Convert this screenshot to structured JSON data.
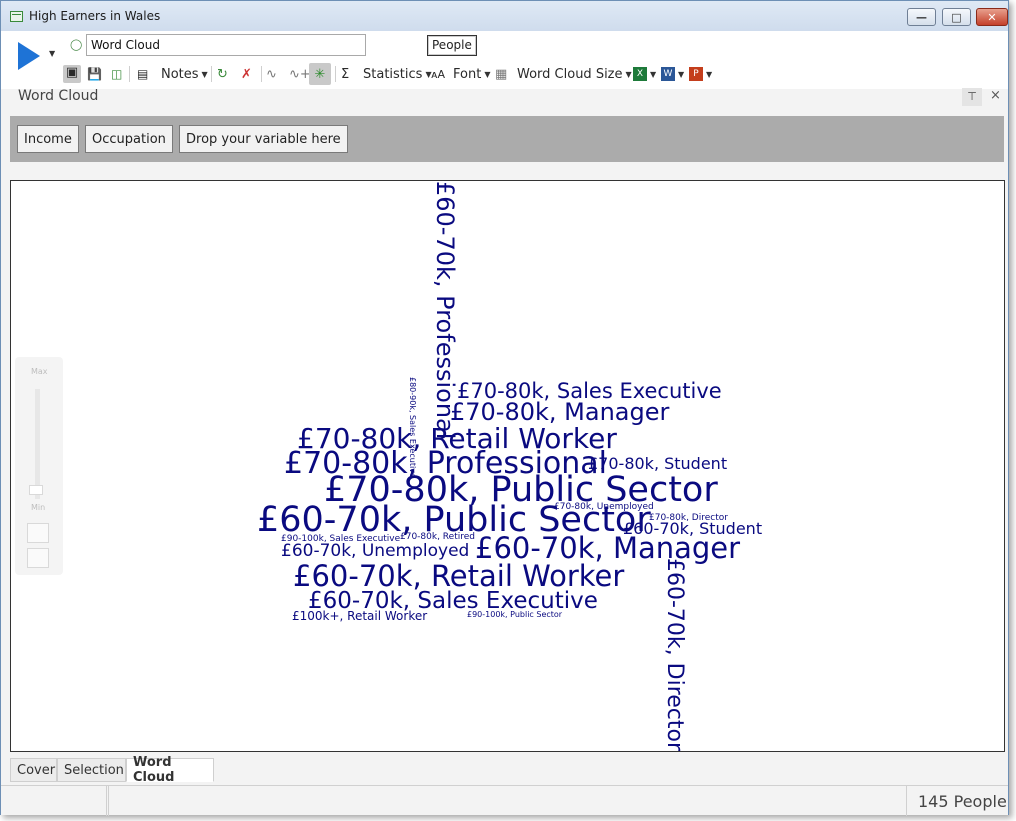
{
  "window": {
    "title": "High Earners in Wales"
  },
  "ribbon": {
    "name_value": "Word Cloud",
    "selection_label": "People",
    "notes_label": "Notes",
    "statistics_label": "Statistics",
    "font_label": "Font",
    "size_label": "Word Cloud Size"
  },
  "panel": {
    "title": "Word Cloud"
  },
  "variables": [
    "Income",
    "Occupation",
    "Drop your variable here"
  ],
  "zoom": {
    "max_label": "Max",
    "min_label": "Min"
  },
  "words": [
    "£60-70k, Professional",
    "£80-90k, Sales Executive",
    "£70-80k, Sales Executive",
    "£70-80k, Manager",
    "£70-80k, Retail Worker",
    "£70-80k, Professional",
    "£70-80k, Student",
    "£70-80k, Public Sector",
    "£70-80k, Unemployed",
    "£70-80k, Director",
    "£60-70k, Public Sector",
    "£60-70k, Student",
    "£90-100k, Sales Executive",
    "£70-80k, Retired",
    "£60-70k, Unemployed",
    "£60-70k, Manager",
    "£60-70k, Retail Worker",
    "£60-70k, Director",
    "£60-70k, Sales Executive",
    "£100k+, Retail Worker",
    "£90-100k, Public Sector"
  ],
  "tabs": [
    "Cover",
    "Selection",
    "Word Cloud"
  ],
  "status": {
    "count": "145 People"
  },
  "colors": {
    "word": "#0a0a80",
    "accent": "#1e73d6"
  }
}
